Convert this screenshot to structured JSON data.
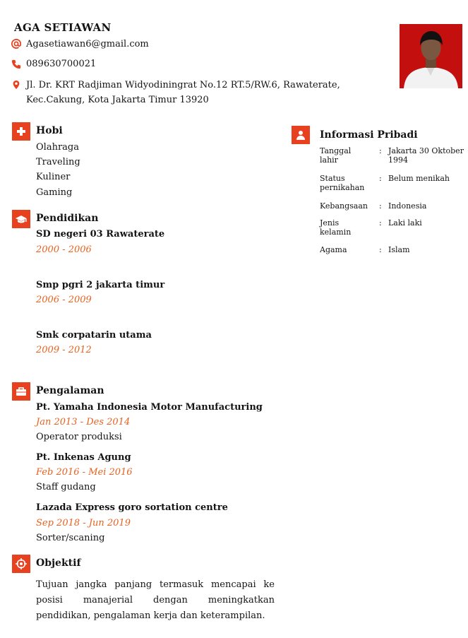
{
  "header": {
    "name": "AGA SETIAWAN",
    "email": "Agasetiawan6@gmail.com",
    "phone": "089630700021",
    "address_line1": "Jl. Dr. KRT Radjiman Widyodiningrat No.12 RT.5/RW.6, Rawaterate,",
    "address_line2": "Kec.Cakung, Kota Jakarta Timur 13920"
  },
  "hobi": {
    "title": "Hobi",
    "items": [
      "Olahraga",
      "Traveling",
      "Kuliner",
      "Gaming"
    ]
  },
  "pendidikan": {
    "title": "Pendidikan",
    "entries": [
      {
        "school": "SD negeri 03 Rawaterate",
        "years": "2000 - 2006"
      },
      {
        "school": "Smp pgri 2 jakarta timur",
        "years": "2006 - 2009"
      },
      {
        "school": "Smk corpatarin utama",
        "years": "2009 - 2012"
      }
    ]
  },
  "pengalaman": {
    "title": "Pengalaman",
    "entries": [
      {
        "company": "Pt. Yamaha Indonesia Motor Manufacturing",
        "period": "Jan 2013 - Des 2014",
        "role": "Operator produksi"
      },
      {
        "company": "Pt. Inkenas Agung",
        "period": "Feb 2016 - Mei 2016",
        "role": "Staff gudang"
      },
      {
        "company": "Lazada Express goro sortation centre",
        "period": "Sep 2018 - Jun 2019",
        "role": "Sorter/scaning"
      }
    ]
  },
  "objektif": {
    "title": "Objektif",
    "text": "Tujuan jangka panjang termasuk mencapai ke posisi manajerial dengan meningkatkan pendidikan, pengalaman kerja dan keterampilan."
  },
  "informasi": {
    "title": "Informasi Pribadi",
    "rows": [
      {
        "label": "Tanggal lahir",
        "value": "Jakarta 30 Oktober 1994"
      },
      {
        "label": "Status pernikahan",
        "value": "Belum menikah"
      },
      {
        "label": "Kebangsaan",
        "value": "Indonesia"
      },
      {
        "label": "Jenis kelamin",
        "value": "Laki laki"
      },
      {
        "label": "Agama",
        "value": "Islam"
      }
    ],
    "colon": ":"
  },
  "colors": {
    "accent": "#e8411f",
    "date": "#e8611f",
    "photo_bg": "#c40f0f"
  },
  "icons": [
    "at-icon",
    "phone-icon",
    "location-pin-icon",
    "medical-cross-icon",
    "graduation-cap-icon",
    "briefcase-icon",
    "target-icon",
    "user-icon"
  ]
}
